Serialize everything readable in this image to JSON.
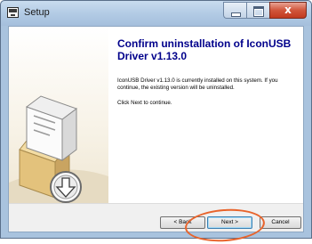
{
  "window": {
    "title": "Setup"
  },
  "caption_buttons": {
    "close_glyph": "x"
  },
  "page": {
    "heading": "Confirm uninstallation of IconUSB Driver v1.13.0",
    "paragraph1": "IconUSB Driver v1.13.0 is currently installed on this system. If you continue, the existing version will be uninstalled.",
    "paragraph2": "Click Next to continue."
  },
  "footer": {
    "back_label": "< Back",
    "next_label": "Next >",
    "cancel_label": "Cancel"
  },
  "colors": {
    "heading": "#00008b",
    "annotation": "#e8642c"
  }
}
